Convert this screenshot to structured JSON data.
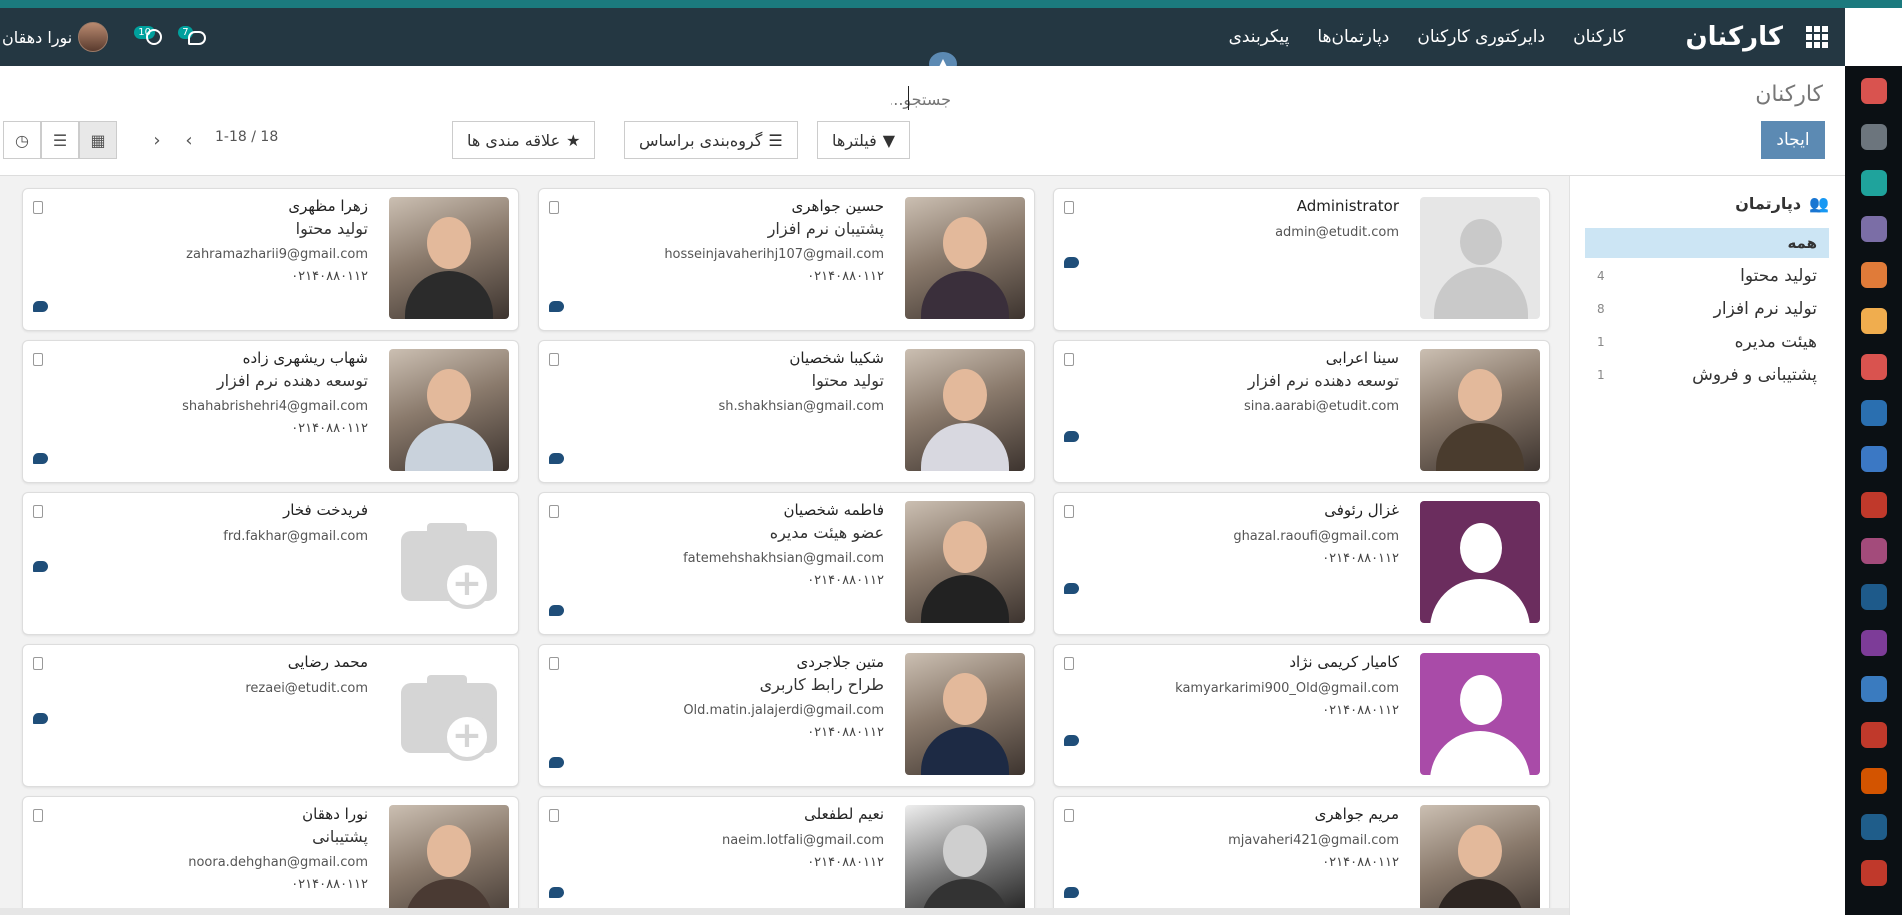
{
  "navbar": {
    "brand": "کارکنان",
    "menu": [
      "کارکنان",
      "دایرکتوری کارکنان",
      "دپارتمان‌ها",
      "پیکربندی"
    ],
    "user_name": "نورا دهقان",
    "activity_count": "10",
    "message_count": "7"
  },
  "control_panel": {
    "breadcrumb": "کارکنان",
    "search_placeholder": "جستجو...",
    "create_label": "ایجاد",
    "filters_label": "فیلترها",
    "groupby_label": "گروه‌بندی براساس",
    "favorites_label": "علاقه مندی ها",
    "pager_range": "1-18",
    "pager_total": "18"
  },
  "departments": {
    "title": "دپارتمان",
    "items": [
      {
        "label": "همه",
        "count": ""
      },
      {
        "label": "تولید محتوا",
        "count": "4"
      },
      {
        "label": "تولید نرم افزار",
        "count": "8"
      },
      {
        "label": "هیئت مدیره",
        "count": "1"
      },
      {
        "label": "پشتیبانی و فروش",
        "count": "1"
      }
    ]
  },
  "employees": [
    {
      "name": "Administrator",
      "job": "",
      "email": "admin@etudit.com",
      "phone": ""
    },
    {
      "name": "حسین جواهری",
      "job": "پشتیبان نرم افزار",
      "email": "hosseinjavaherihj107@gmail.com",
      "phone": "۰۲۱۴۰۸۸۰۱۱۲"
    },
    {
      "name": "زهرا مظهری",
      "job": "تولید محتوا",
      "email": "zahramazharii9@gmail.com",
      "phone": "۰۲۱۴۰۸۸۰۱۱۲"
    },
    {
      "name": "سینا اعرابی",
      "job": "توسعه دهنده نرم افزار",
      "email": "sina.aarabi@etudit.com",
      "phone": ""
    },
    {
      "name": "شکیبا شخصیان",
      "job": "تولید محتوا",
      "email": "sh.shakhsian@gmail.com",
      "phone": ""
    },
    {
      "name": "شهاب ریشهری زاده",
      "job": "توسعه دهنده نرم افزار",
      "email": "shahabrishehri4@gmail.com",
      "phone": "۰۲۱۴۰۸۸۰۱۱۲"
    },
    {
      "name": "غزال رئوفی",
      "job": "",
      "email": "ghazal.raoufi@gmail.com",
      "phone": "۰۲۱۴۰۸۸۰۱۱۲"
    },
    {
      "name": "فاطمه شخصیان",
      "job": "عضو هیئت مدیره",
      "email": "fatemehshakhsian@gmail.com",
      "phone": "۰۲۱۴۰۸۸۰۱۱۲"
    },
    {
      "name": "فریدخت فخار",
      "job": "",
      "email": "frd.fakhar@gmail.com",
      "phone": ""
    },
    {
      "name": "کامیار کریمی نژاد",
      "job": "",
      "email": "kamyarkarimi900_Old@gmail.com",
      "phone": "۰۲۱۴۰۸۸۰۱۱۲"
    },
    {
      "name": "متین جلاجردی",
      "job": "طراح رابط کاربری",
      "email": "Old.matin.jalajerdi@gmail.com",
      "phone": "۰۲۱۴۰۸۸۰۱۱۲"
    },
    {
      "name": "محمد رضایی",
      "job": "",
      "email": "rezaei@etudit.com",
      "phone": ""
    },
    {
      "name": "مریم جواهری",
      "job": "",
      "email": "mjavaheri421@gmail.com",
      "phone": "۰۲۱۴۰۸۸۰۱۱۲"
    },
    {
      "name": "نعیم لطفعلی",
      "job": "",
      "email": "naeim.lotfali@gmail.com",
      "phone": "۰۲۱۴۰۸۸۰۱۱۲"
    },
    {
      "name": "نورا دهقان",
      "job": "پشتیبانی",
      "email": "noora.dehghan@gmail.com",
      "phone": "۰۲۱۴۰۸۸۰۱۱۲"
    }
  ]
}
